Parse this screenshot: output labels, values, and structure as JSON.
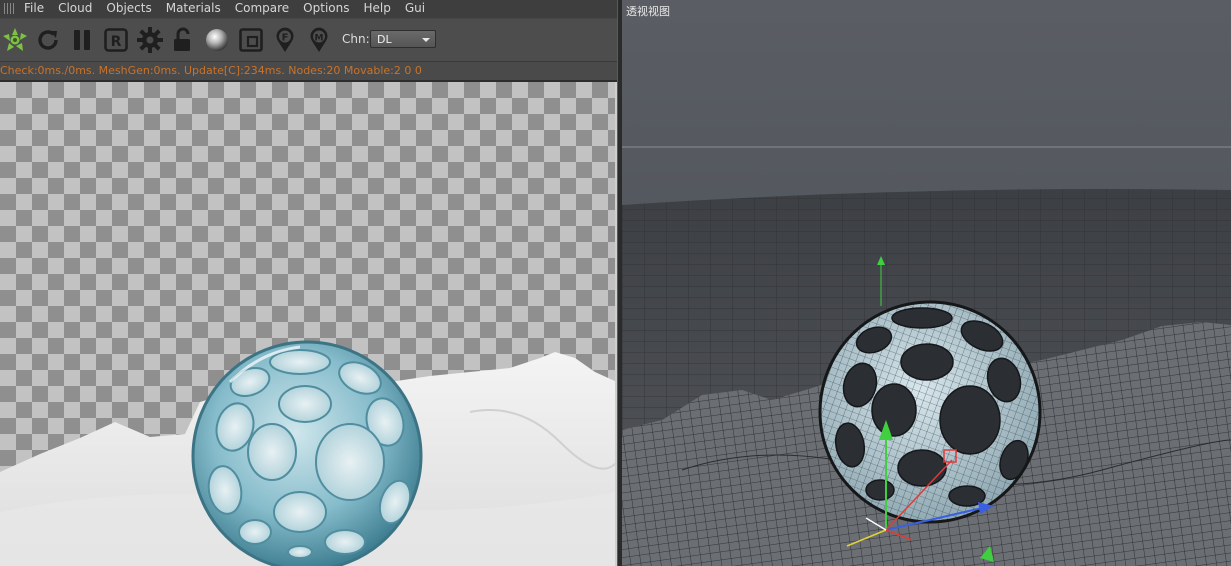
{
  "menubar": {
    "items": [
      "File",
      "Cloud",
      "Objects",
      "Materials",
      "Compare",
      "Options",
      "Help",
      "Gui"
    ]
  },
  "toolbar": {
    "icons": [
      "octane-logo-icon",
      "refresh-icon",
      "pause-icon",
      "reset-r-icon",
      "settings-gear-icon",
      "lock-icon",
      "material-ball-icon",
      "region-render-icon",
      "focus-pin-icon",
      "material-pin-icon"
    ],
    "channel_label": "Chn:",
    "channel_value": "DL"
  },
  "status": {
    "text": "Check:0ms./0ms. MeshGen:0ms. Update[C]:234ms. Nodes:20 Movable:2  0 0"
  },
  "viewport": {
    "title": "透视视图"
  },
  "colors": {
    "status_text": "#c8732b",
    "logo_green": "#7dc242",
    "sphere_teal": "#6fa7b6",
    "axis_x": "#e03a3a",
    "axis_y": "#3fcf3f",
    "axis_z": "#3a5fe0"
  }
}
